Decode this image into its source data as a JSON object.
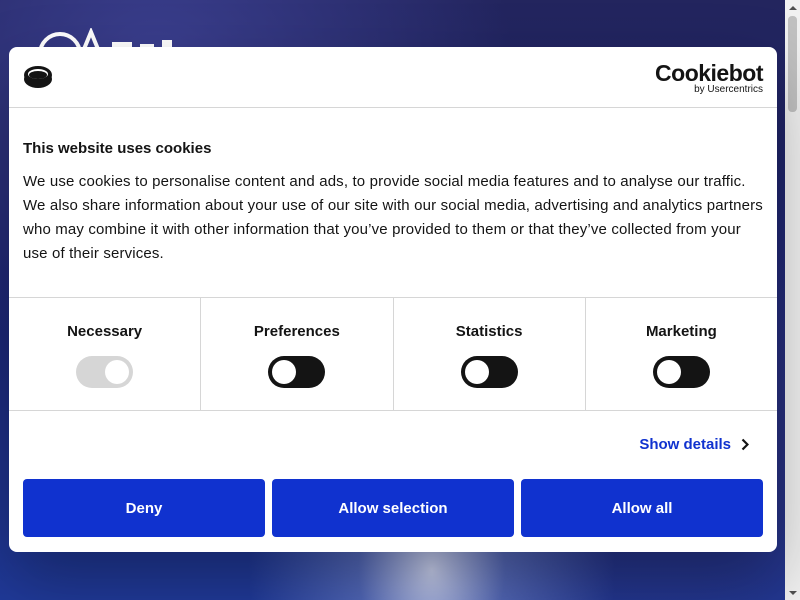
{
  "dialog": {
    "brand": {
      "word": "Cookiebot",
      "sub": "by Usercentrics"
    },
    "title": "This website uses cookies",
    "text": "We use cookies to personalise content and ads, to provide social media features and to analyse our traffic. We also share information about your use of our site with our social media, advertising and analytics partners who may combine it with other information that you’ve provided to them or that they’ve collected from your use of their services.",
    "toggles": [
      {
        "label": "Necessary",
        "on": true,
        "disabled": true
      },
      {
        "label": "Preferences",
        "on": false,
        "disabled": false
      },
      {
        "label": "Statistics",
        "on": false,
        "disabled": false
      },
      {
        "label": "Marketing",
        "on": false,
        "disabled": false
      }
    ],
    "show_details": "Show details",
    "buttons": {
      "deny": "Deny",
      "allow_selection": "Allow selection",
      "allow_all": "Allow all"
    }
  },
  "colors": {
    "accent": "#1032cf",
    "text": "#141414",
    "border": "#d6d6d6"
  },
  "icons": [
    "cookie-icon",
    "chevron-right-icon",
    "scroll-up-icon",
    "scroll-down-icon"
  ]
}
